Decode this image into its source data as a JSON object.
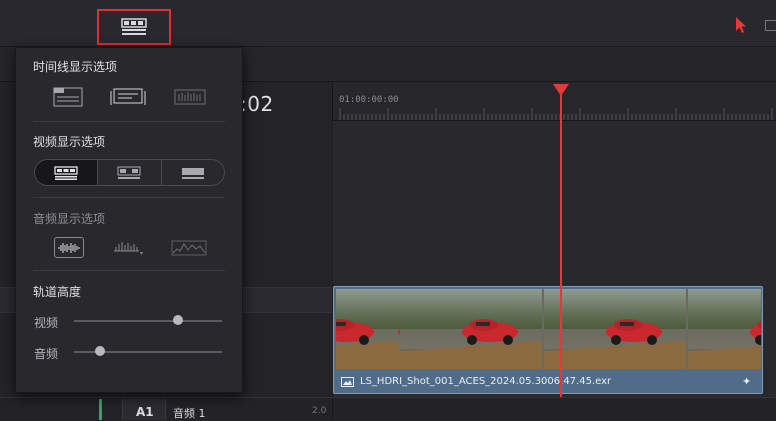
{
  "toolbar": {
    "view_options_icon": "timeline-view-options-icon",
    "pointer_icon": "selection-pointer-icon"
  },
  "timeline": {
    "timecode": ":02",
    "ruler_start": "01:00:00:00",
    "clip_name": "LS_HDRI_Shot_001_ACES_2024.05.3006.47.45.exr",
    "clip_fx_icon": "sparkle-icon"
  },
  "audio_track": {
    "id": "A1",
    "name": "音频 1",
    "value": "2.0"
  },
  "popup": {
    "timeline_display_title": "时间线显示选项",
    "video_display_title": "视频显示选项",
    "audio_display_title": "音频显示选项",
    "track_height_title": "轨道高度",
    "video_label": "视频",
    "audio_label": "音频",
    "video_track_height": 0.72,
    "audio_track_height": 0.15
  },
  "colors": {
    "playhead": "#e03a3a",
    "highlight_box": "#e03030",
    "clip": "#516c88",
    "audio_accent": "#3aa26a"
  }
}
